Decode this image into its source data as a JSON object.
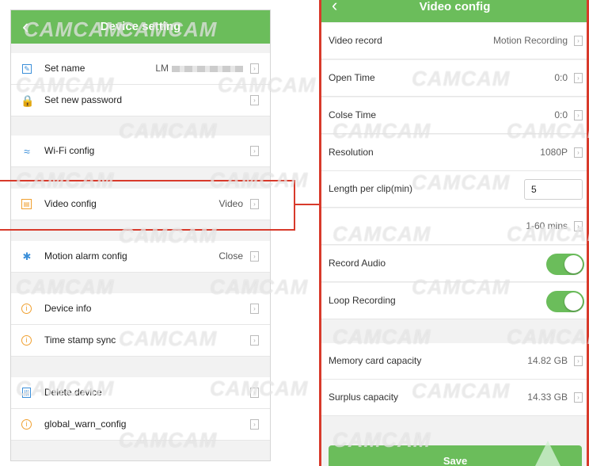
{
  "left": {
    "title": "Device setting",
    "rows": {
      "set_name": {
        "label": "Set name",
        "value": "LM"
      },
      "set_password": {
        "label": "Set new password"
      },
      "wifi": {
        "label": "Wi-Fi config"
      },
      "video": {
        "label": "Video config",
        "value": "Video"
      },
      "motion": {
        "label": "Motion alarm config",
        "value": "Close"
      },
      "device_info": {
        "label": "Device info"
      },
      "timestamp": {
        "label": "Time stamp sync"
      },
      "delete": {
        "label": "Delete device"
      },
      "warn": {
        "label": "global_warn_config"
      }
    }
  },
  "right": {
    "title": "Video config",
    "rows": {
      "video_record": {
        "label": "Video record",
        "value": "Motion Recording"
      },
      "open_time": {
        "label": "Open Time",
        "value": "0:0"
      },
      "close_time": {
        "label": "Colse Time",
        "value": "0:0"
      },
      "resolution": {
        "label": "Resolution",
        "value": "1080P"
      },
      "clip_length": {
        "label": "Length per clip(min)",
        "value": "5"
      },
      "clip_range": {
        "value": "1-60 mins"
      },
      "record_audio": {
        "label": "Record Audio",
        "on": true
      },
      "loop_recording": {
        "label": "Loop Recording",
        "on": true
      },
      "memory_capacity": {
        "label": "Memory card capacity",
        "value": "14.82 GB"
      },
      "surplus_capacity": {
        "label": "Surplus capacity",
        "value": "14.33 GB"
      }
    },
    "save_label": "Save"
  },
  "watermark": "CAMCAM",
  "colors": {
    "accent": "#6bbd5b",
    "highlight": "#d83a2b",
    "icon_blue": "#3b8fd9",
    "icon_orange": "#f0a030"
  }
}
